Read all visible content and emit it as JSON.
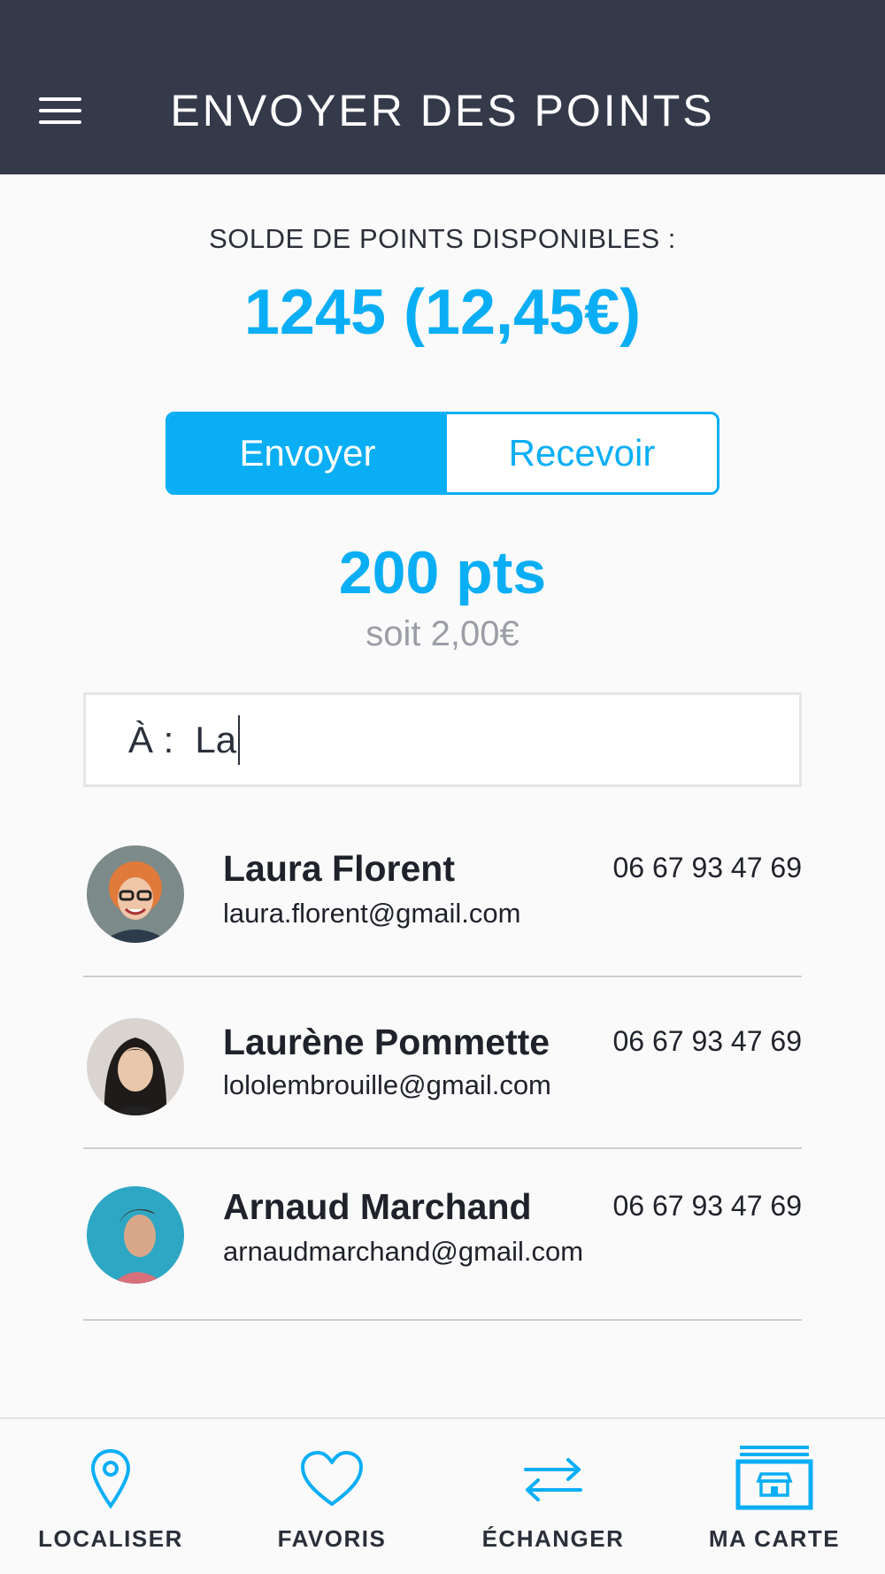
{
  "header": {
    "title": "ENVOYER DES POINTS"
  },
  "balance": {
    "label": "SOLDE DE POINTS DISPONIBLES :",
    "value": "1245 (12,45€)"
  },
  "toggle": {
    "send": "Envoyer",
    "receive": "Recevoir",
    "selected": "Envoyer"
  },
  "amount": {
    "value": "200 pts",
    "equivalent": "soit 2,00€"
  },
  "recipient": {
    "label": "À :",
    "value": "La"
  },
  "contacts": [
    {
      "name": "Laura Florent",
      "email": "laura.florent@gmail.com",
      "phone": "06 67 93 47 69"
    },
    {
      "name": "Laurène Pommette",
      "email": "lololembrouille@gmail.com",
      "phone": "06 67 93 47 69"
    },
    {
      "name": "Arnaud Marchand",
      "email": "arnaudmarchand@gmail.com",
      "phone": "06 67 93 47 69"
    }
  ],
  "tabbar": [
    {
      "label": "LOCALISER",
      "icon": "location-pin-icon"
    },
    {
      "label": "FAVORIS",
      "icon": "heart-icon"
    },
    {
      "label": "ÉCHANGER",
      "icon": "exchange-arrows-icon"
    },
    {
      "label": "MA CARTE",
      "icon": "card-store-icon"
    }
  ],
  "colors": {
    "header": "#343a49",
    "accent": "#0aaef5",
    "muted": "#9b9ea6"
  }
}
